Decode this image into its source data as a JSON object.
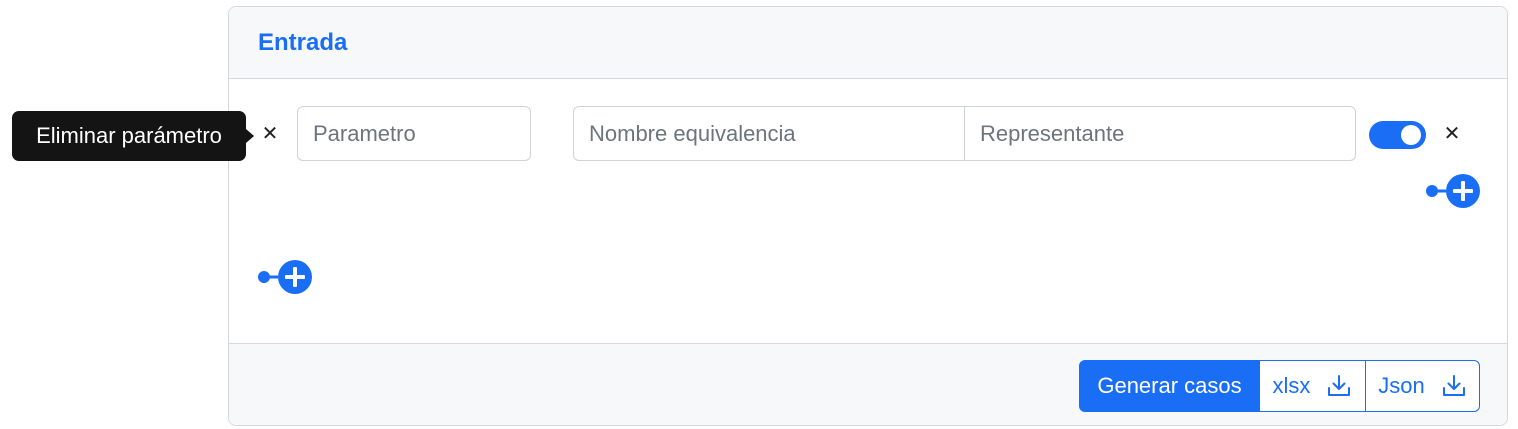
{
  "card": {
    "title": "Entrada"
  },
  "tooltip": {
    "text": "Eliminar parámetro"
  },
  "parameter": {
    "name_placeholder": "Parametro",
    "remove_icon": "close-icon"
  },
  "equivalence": {
    "name_placeholder": "Nombre equivalencia",
    "representative_placeholder": "Representante",
    "valid_toggle_on": true,
    "remove_icon": "close-icon"
  },
  "icons": {
    "add_equivalence": "plus-circle-icon",
    "add_parameter": "plus-circle-icon"
  },
  "footer": {
    "generate_label": "Generar casos",
    "xlsx_label": "xlsx",
    "json_label": "Json"
  },
  "colors": {
    "accent": "#1a6ef5",
    "tooltip_bg": "#141414",
    "header_bg": "#f7f8fa"
  }
}
